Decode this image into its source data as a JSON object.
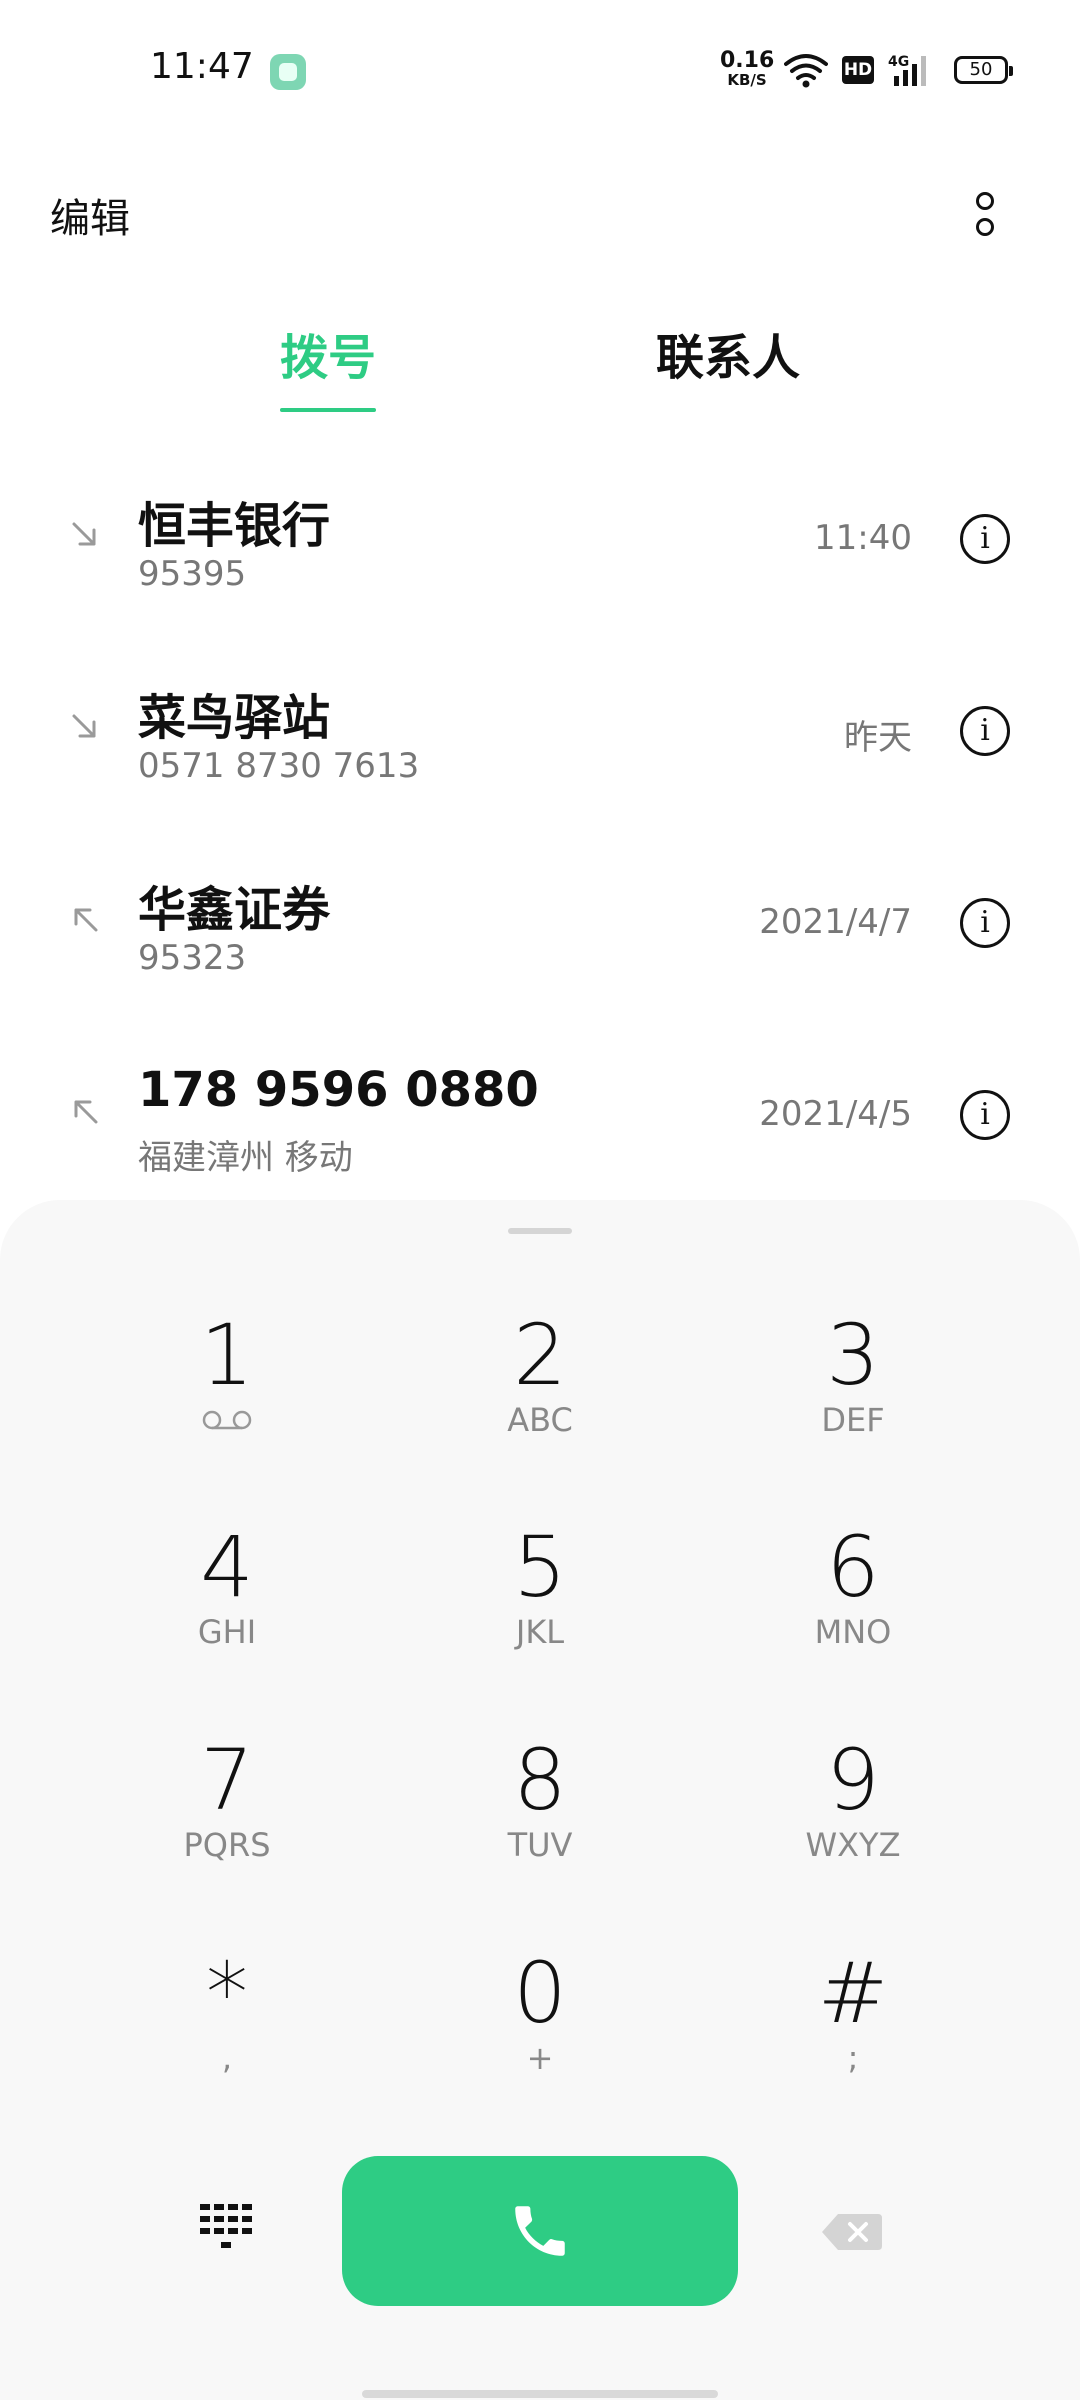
{
  "status_bar": {
    "time": "11:47",
    "net_speed_value": "0.16",
    "net_speed_unit": "KB/S",
    "hd_label": "HD",
    "network_label": "4G",
    "battery": "50"
  },
  "top_bar": {
    "edit_label": "编辑"
  },
  "tabs": [
    {
      "label": "拨号",
      "active": true
    },
    {
      "label": "联系人",
      "active": false
    }
  ],
  "call_log": [
    {
      "name": "恒丰银行",
      "subtitle": "95395",
      "time": "11:40",
      "direction": "incoming"
    },
    {
      "name": "菜鸟驿站",
      "subtitle": "0571 8730 7613",
      "time": "昨天",
      "direction": "incoming"
    },
    {
      "name": "华鑫证券",
      "subtitle": "95323",
      "time": "2021/4/7",
      "direction": "outgoing"
    },
    {
      "name": "178 9596 0880",
      "subtitle": "福建漳州 移动",
      "time": "2021/4/5",
      "direction": "outgoing"
    }
  ],
  "keypad": [
    {
      "digit": "1",
      "letters": ""
    },
    {
      "digit": "2",
      "letters": "ABC"
    },
    {
      "digit": "3",
      "letters": "DEF"
    },
    {
      "digit": "4",
      "letters": "GHI"
    },
    {
      "digit": "5",
      "letters": "JKL"
    },
    {
      "digit": "6",
      "letters": "MNO"
    },
    {
      "digit": "7",
      "letters": "PQRS"
    },
    {
      "digit": "8",
      "letters": "TUV"
    },
    {
      "digit": "9",
      "letters": "WXYZ"
    },
    {
      "digit": "*",
      "letters": ","
    },
    {
      "digit": "0",
      "letters": "+"
    },
    {
      "digit": "#",
      "letters": ";"
    }
  ],
  "colors": {
    "accent": "#2ecc84",
    "secondary_text": "#777777"
  },
  "icons": {
    "incoming": "call-incoming-icon",
    "outgoing": "call-outgoing-icon",
    "info": "info-icon",
    "voicemail": "voicemail-icon",
    "keypad_toggle": "dialpad-icon",
    "call": "phone-icon",
    "backspace": "backspace-icon"
  }
}
